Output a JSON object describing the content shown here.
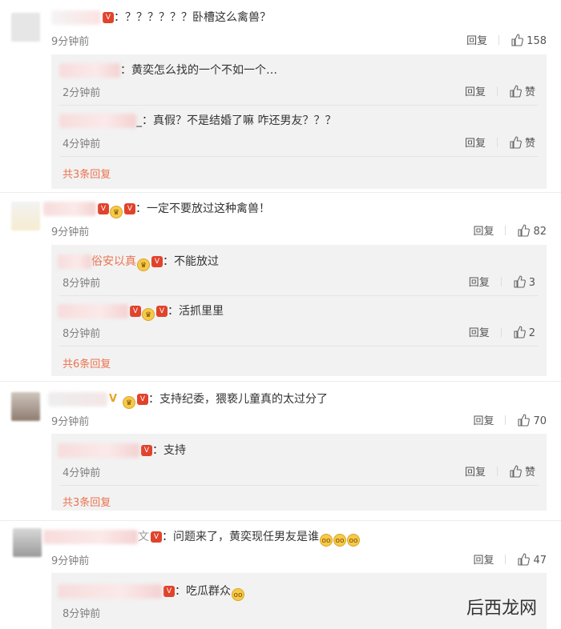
{
  "comments": [
    {
      "text": "：？？？？？？卧槽这么禽兽？",
      "time": "9分钟前",
      "reply_label": "回复",
      "likes": "158",
      "replies": [
        {
          "text": "：黄奕怎么找的一个不如一个…",
          "time": "2分钟前",
          "reply_label": "回复",
          "like_label": "赞"
        },
        {
          "text": "_：真假？不是结婚了嘛 咋还男友？？？",
          "time": "4分钟前",
          "reply_label": "回复",
          "like_label": "赞"
        }
      ],
      "more": "共3条回复"
    },
    {
      "text": "：一定不要放过这种禽兽！",
      "time": "9分钟前",
      "reply_label": "回复",
      "likes": "82",
      "replies": [
        {
          "name_tail": "俗安以真",
          "text": "：不能放过",
          "time": "8分钟前",
          "reply_label": "回复",
          "likes": "3"
        },
        {
          "text": "：活抓里里",
          "time": "8分钟前",
          "reply_label": "回复",
          "likes": "2"
        }
      ],
      "more": "共6条回复"
    },
    {
      "text": "：支持纪委，猥亵儿童真的太过分了",
      "time": "9分钟前",
      "reply_label": "回复",
      "likes": "70",
      "replies": [
        {
          "text": "：支持",
          "time": "4分钟前",
          "reply_label": "回复",
          "like_label": "赞"
        }
      ],
      "more": "共3条回复"
    },
    {
      "name_tail": "文",
      "text": "：问题来了，黄奕现任男友是谁",
      "time": "9分钟前",
      "reply_label": "回复",
      "likes": "47",
      "replies": [
        {
          "text": "：吃瓜群众",
          "time": "8分钟前"
        }
      ]
    }
  ],
  "watermark": "后西龙网",
  "colors": {
    "more": "#eb7350",
    "sub_bg": "#f2f2f2",
    "vip": "#e0432c"
  }
}
